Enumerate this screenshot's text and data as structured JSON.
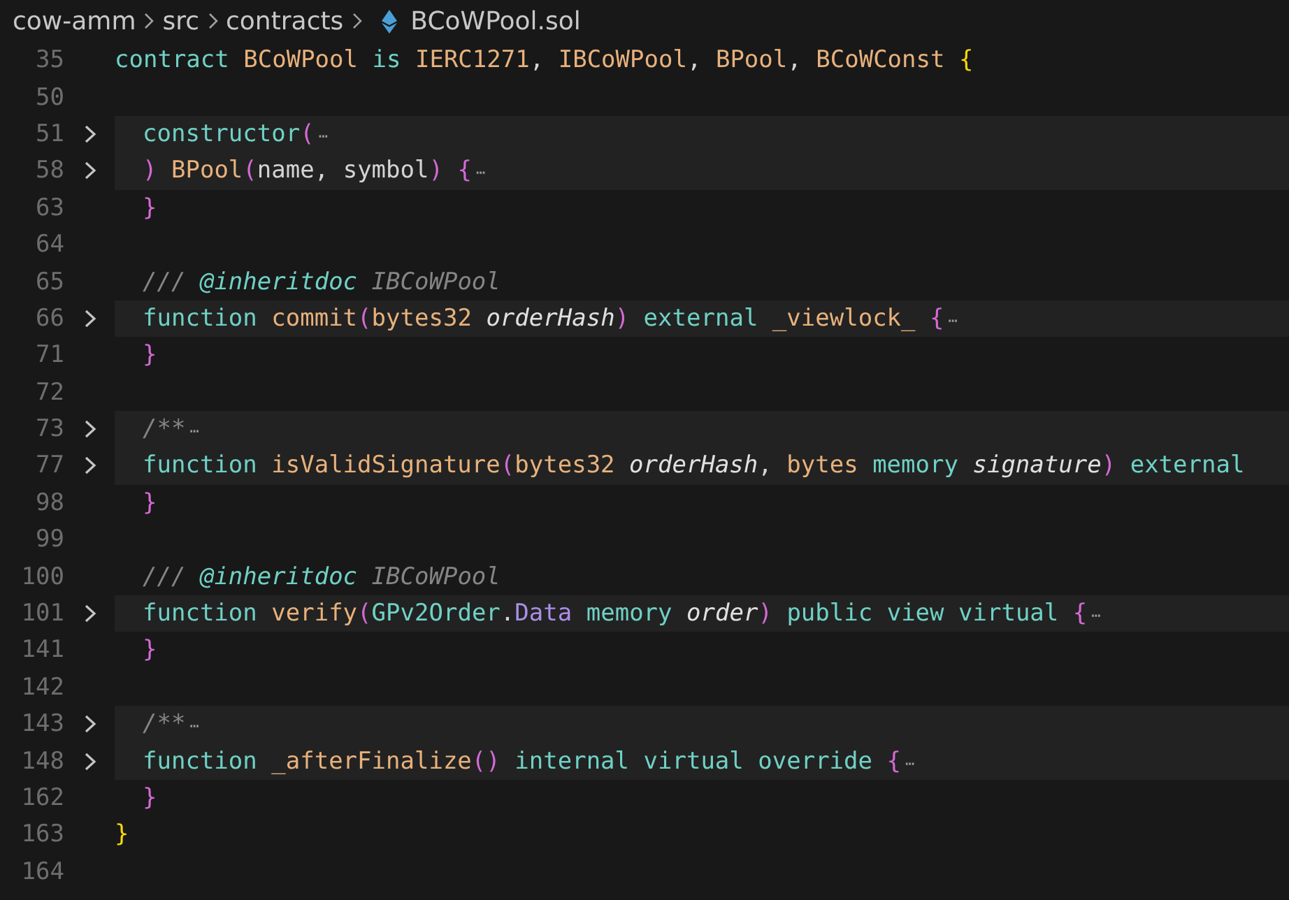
{
  "breadcrumb": [
    {
      "label": "cow-amm",
      "kind": "folder"
    },
    {
      "label": "src",
      "kind": "folder"
    },
    {
      "label": "contracts",
      "kind": "folder"
    },
    {
      "label": "BCoWPool.sol",
      "kind": "file"
    }
  ],
  "lines": [
    {
      "number": "35",
      "folded": false,
      "indented": false,
      "tokens": [
        {
          "text": "contract ",
          "kind": "keyword"
        },
        {
          "text": "BCoWPool",
          "kind": "type"
        },
        {
          "text": " is ",
          "kind": "keyword"
        },
        {
          "text": "IERC1271",
          "kind": "type"
        },
        {
          "text": ", ",
          "kind": "plain"
        },
        {
          "text": "IBCoWPool",
          "kind": "type"
        },
        {
          "text": ", ",
          "kind": "plain"
        },
        {
          "text": "BPool",
          "kind": "type"
        },
        {
          "text": ", ",
          "kind": "plain"
        },
        {
          "text": "BCoWConst",
          "kind": "type"
        },
        {
          "text": " {",
          "kind": "brace"
        }
      ]
    },
    {
      "number": "50",
      "folded": false
    },
    {
      "number": "51",
      "folded": true,
      "indented": true,
      "tokens": [
        {
          "text": "constructor",
          "kind": "keyword"
        },
        {
          "text": "(",
          "kind": "paren"
        },
        {
          "text": "⋯",
          "kind": "fold"
        }
      ]
    },
    {
      "number": "58",
      "folded": true,
      "indented": true,
      "tokens": [
        {
          "text": ")",
          "kind": "paren"
        },
        {
          "text": " BPool",
          "kind": "type"
        },
        {
          "text": "(",
          "kind": "paren"
        },
        {
          "text": "name, symbol",
          "kind": "plain"
        },
        {
          "text": ")",
          "kind": "paren"
        },
        {
          "text": " {",
          "kind": "paren"
        },
        {
          "text": "⋯",
          "kind": "fold"
        }
      ]
    },
    {
      "number": "63",
      "folded": false,
      "indented": true,
      "tokens": [
        {
          "text": "}",
          "kind": "paren"
        }
      ]
    },
    {
      "number": "64",
      "folded": false
    },
    {
      "number": "65",
      "folded": false,
      "indented": true,
      "tokens": [
        {
          "text": "/// ",
          "kind": "comment"
        },
        {
          "text": "@inheritdoc",
          "kind": "tag"
        },
        {
          "text": " IBCoWPool",
          "kind": "comment"
        }
      ]
    },
    {
      "number": "66",
      "folded": true,
      "indented": true,
      "tokens": [
        {
          "text": "function ",
          "kind": "keyword"
        },
        {
          "text": "commit",
          "kind": "type"
        },
        {
          "text": "(",
          "kind": "paren"
        },
        {
          "text": "bytes32 ",
          "kind": "type"
        },
        {
          "text": "orderHash",
          "kind": "param"
        },
        {
          "text": ")",
          "kind": "paren"
        },
        {
          "text": " external ",
          "kind": "keyword"
        },
        {
          "text": "_viewlock_",
          "kind": "type"
        },
        {
          "text": " {",
          "kind": "paren"
        },
        {
          "text": "⋯",
          "kind": "fold"
        }
      ]
    },
    {
      "number": "71",
      "folded": false,
      "indented": true,
      "tokens": [
        {
          "text": "}",
          "kind": "paren"
        }
      ]
    },
    {
      "number": "72",
      "folded": false
    },
    {
      "number": "73",
      "folded": true,
      "indented": true,
      "tokens": [
        {
          "text": "/**",
          "kind": "comment"
        },
        {
          "text": "⋯",
          "kind": "fold"
        }
      ]
    },
    {
      "number": "77",
      "folded": true,
      "indented": true,
      "tokens": [
        {
          "text": "function ",
          "kind": "keyword"
        },
        {
          "text": "isValidSignature",
          "kind": "type"
        },
        {
          "text": "(",
          "kind": "paren"
        },
        {
          "text": "bytes32 ",
          "kind": "type"
        },
        {
          "text": "orderHash",
          "kind": "param"
        },
        {
          "text": ", ",
          "kind": "plain"
        },
        {
          "text": "bytes ",
          "kind": "type"
        },
        {
          "text": "memory ",
          "kind": "keyword"
        },
        {
          "text": "signature",
          "kind": "param"
        },
        {
          "text": ")",
          "kind": "paren"
        },
        {
          "text": " external",
          "kind": "keyword"
        }
      ]
    },
    {
      "number": "98",
      "folded": false,
      "indented": true,
      "tokens": [
        {
          "text": "}",
          "kind": "paren"
        }
      ]
    },
    {
      "number": "99",
      "folded": false
    },
    {
      "number": "100",
      "folded": false,
      "indented": true,
      "tokens": [
        {
          "text": "/// ",
          "kind": "comment"
        },
        {
          "text": "@inheritdoc",
          "kind": "tag"
        },
        {
          "text": " IBCoWPool",
          "kind": "comment"
        }
      ]
    },
    {
      "number": "101",
      "folded": true,
      "indented": true,
      "tokens": [
        {
          "text": "function ",
          "kind": "keyword"
        },
        {
          "text": "verify",
          "kind": "type"
        },
        {
          "text": "(",
          "kind": "paren"
        },
        {
          "text": "GPv2Order",
          "kind": "keyword"
        },
        {
          "text": ".",
          "kind": "plain"
        },
        {
          "text": "Data ",
          "kind": "struct"
        },
        {
          "text": "memory ",
          "kind": "keyword"
        },
        {
          "text": "order",
          "kind": "param"
        },
        {
          "text": ")",
          "kind": "paren"
        },
        {
          "text": " public view virtual ",
          "kind": "keyword"
        },
        {
          "text": "{",
          "kind": "paren"
        },
        {
          "text": "⋯",
          "kind": "fold"
        }
      ]
    },
    {
      "number": "141",
      "folded": false,
      "indented": true,
      "tokens": [
        {
          "text": "}",
          "kind": "paren"
        }
      ]
    },
    {
      "number": "142",
      "folded": false
    },
    {
      "number": "143",
      "folded": true,
      "indented": true,
      "tokens": [
        {
          "text": "/**",
          "kind": "comment"
        },
        {
          "text": "⋯",
          "kind": "fold"
        }
      ]
    },
    {
      "number": "148",
      "folded": true,
      "indented": true,
      "tokens": [
        {
          "text": "function ",
          "kind": "keyword"
        },
        {
          "text": "_afterFinalize",
          "kind": "type"
        },
        {
          "text": "()",
          "kind": "paren"
        },
        {
          "text": " internal virtual override ",
          "kind": "keyword"
        },
        {
          "text": "{",
          "kind": "paren"
        },
        {
          "text": "⋯",
          "kind": "fold"
        }
      ]
    },
    {
      "number": "162",
      "folded": false,
      "indented": true,
      "tokens": [
        {
          "text": "}",
          "kind": "paren"
        }
      ]
    },
    {
      "number": "163",
      "folded": false,
      "indented": false,
      "tokens": [
        {
          "text": "}",
          "kind": "brace"
        }
      ]
    },
    {
      "number": "164",
      "folded": false
    }
  ]
}
